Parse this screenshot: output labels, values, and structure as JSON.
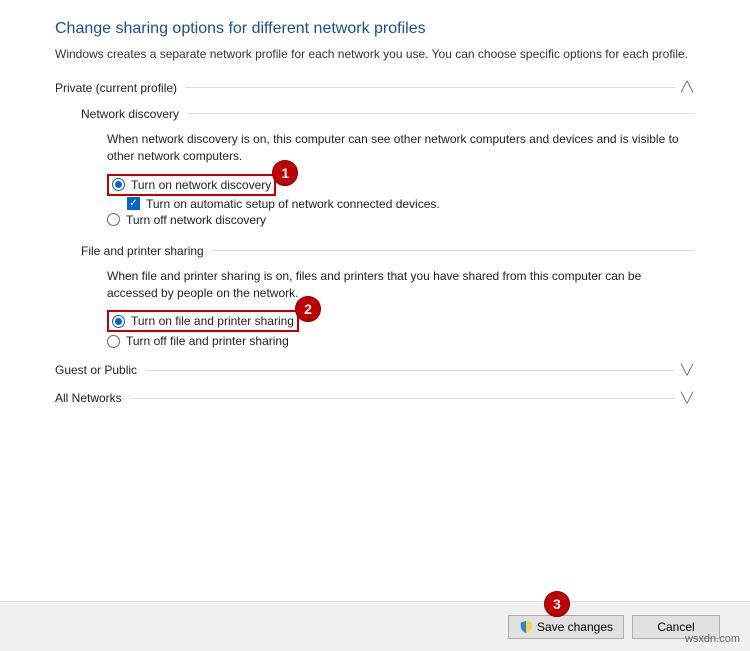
{
  "heading": "Change sharing options for different network profiles",
  "subheading": "Windows creates a separate network profile for each network you use. You can choose specific options for each profile.",
  "private": {
    "title": "Private (current profile)",
    "networkDiscovery": {
      "title": "Network discovery",
      "desc": "When network discovery is on, this computer can see other network computers and devices and is visible to other network computers.",
      "on": "Turn on network discovery",
      "auto": "Turn on automatic setup of network connected devices.",
      "off": "Turn off network discovery"
    },
    "filePrinter": {
      "title": "File and printer sharing",
      "desc": "When file and printer sharing is on, files and printers that you have shared from this computer can be accessed by people on the network.",
      "on": "Turn on file and printer sharing",
      "off": "Turn off file and printer sharing"
    }
  },
  "guest": {
    "title": "Guest or Public"
  },
  "allNetworks": {
    "title": "All Networks"
  },
  "footer": {
    "save": "Save changes",
    "cancel": "Cancel"
  },
  "annotations": {
    "a1": "1",
    "a2": "2",
    "a3": "3"
  },
  "watermark": "wsxdn.com"
}
